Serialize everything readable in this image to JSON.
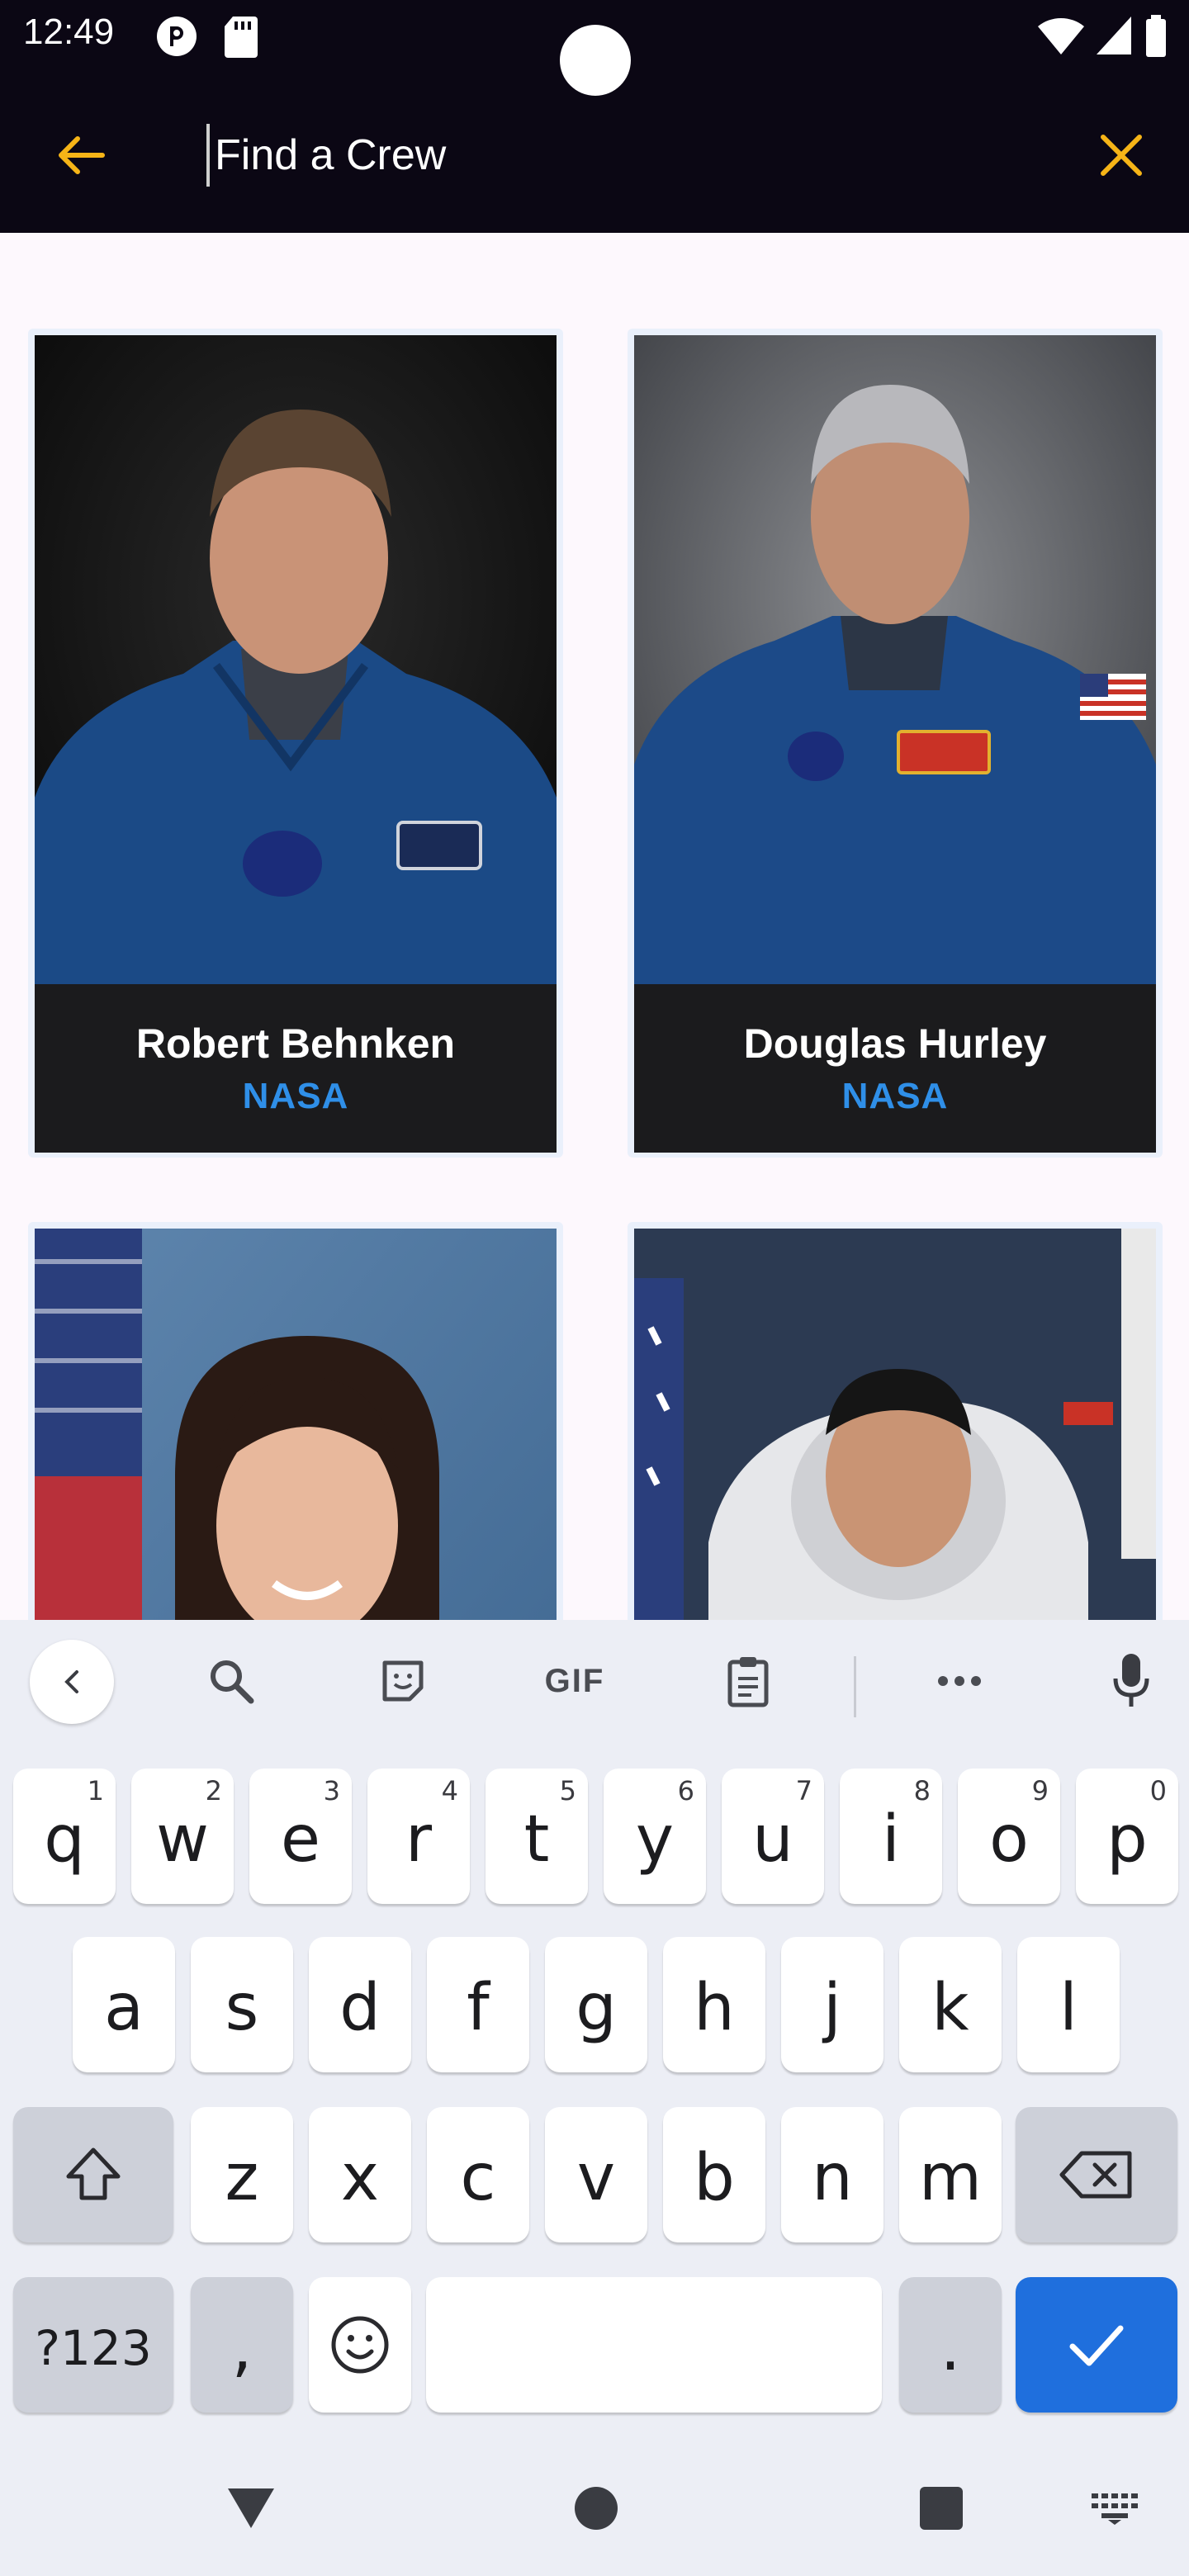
{
  "status_bar": {
    "time": "12:49"
  },
  "app_bar": {
    "search_placeholder": "Find a Crew",
    "accent_color": "#f6b417"
  },
  "crew": [
    {
      "name": "Robert Behnken",
      "agency": "NASA"
    },
    {
      "name": "Douglas Hurley",
      "agency": "NASA"
    },
    {
      "name": "",
      "agency": ""
    },
    {
      "name": "",
      "agency": ""
    }
  ],
  "keyboard": {
    "toolbar": {
      "gif_label": "GIF"
    },
    "row1": [
      {
        "key": "q",
        "hint": "1"
      },
      {
        "key": "w",
        "hint": "2"
      },
      {
        "key": "e",
        "hint": "3"
      },
      {
        "key": "r",
        "hint": "4"
      },
      {
        "key": "t",
        "hint": "5"
      },
      {
        "key": "y",
        "hint": "6"
      },
      {
        "key": "u",
        "hint": "7"
      },
      {
        "key": "i",
        "hint": "8"
      },
      {
        "key": "o",
        "hint": "9"
      },
      {
        "key": "p",
        "hint": "0"
      }
    ],
    "row2": [
      "a",
      "s",
      "d",
      "f",
      "g",
      "h",
      "j",
      "k",
      "l"
    ],
    "row3": [
      "z",
      "x",
      "c",
      "v",
      "b",
      "n",
      "m"
    ],
    "row4": {
      "symbols_label": "?123",
      "comma": ",",
      "period": "."
    }
  }
}
